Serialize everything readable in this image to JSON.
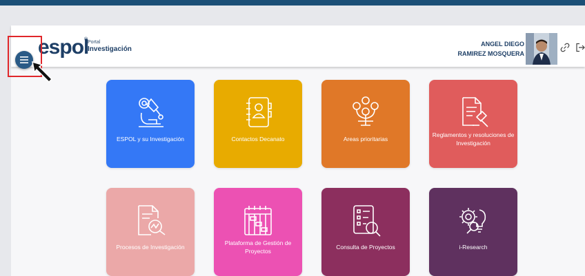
{
  "header": {
    "logo_word": "espol",
    "logo_reg": "®",
    "logo_portal": "Portal",
    "logo_name": "Investigación",
    "user_name_line1": "ANGEL DIEGO",
    "user_name_line2": "RAMIREZ MOSQUERA",
    "menu_icon": "hamburger-icon",
    "link_icon": "link-icon",
    "logout_icon": "logout-icon"
  },
  "tiles": [
    {
      "label": "ESPOL y su Investigación",
      "color": "#3478f6",
      "icon": "microscope-icon"
    },
    {
      "label": "Contactos Decanato",
      "color": "#e8ab00",
      "icon": "contacts-book-icon"
    },
    {
      "label": "Areas prioritarias",
      "color": "#e07828",
      "icon": "priority-tree-icon"
    },
    {
      "label": "Reglamentos y resoluciones de Investigación",
      "color": "#e05c5c",
      "icon": "document-gavel-icon"
    },
    {
      "label": "Procesos de Investigación",
      "color": "#eba8a8",
      "icon": "document-search-icon"
    },
    {
      "label": "Plataforma de Gestión de Proyectos",
      "color": "#ec51b3",
      "icon": "project-board-icon"
    },
    {
      "label": "Consulta de Proyectos",
      "color": "#8c2f5e",
      "icon": "checklist-search-icon"
    },
    {
      "label": "i-Research",
      "color": "#5f315f",
      "icon": "gear-bulb-icon"
    }
  ]
}
